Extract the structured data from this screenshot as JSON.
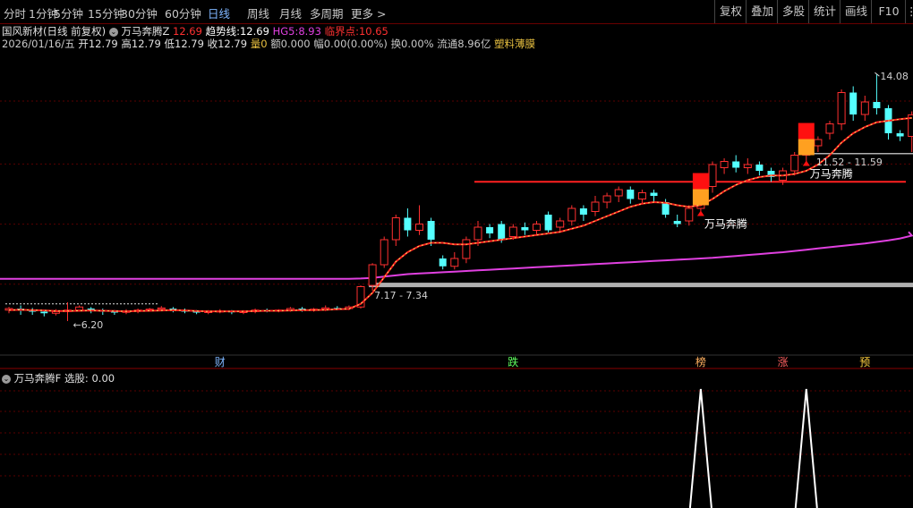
{
  "toolbar": {
    "periods": [
      {
        "label": "分时",
        "active": false
      },
      {
        "label": "1分钟",
        "active": false
      },
      {
        "label": "5分钟",
        "active": false
      },
      {
        "label": "15分钟",
        "active": false
      },
      {
        "label": "30分钟",
        "active": false
      },
      {
        "label": "60分钟",
        "active": false
      },
      {
        "label": "日线",
        "active": true
      },
      {
        "label": "周线",
        "active": false
      },
      {
        "label": "月线",
        "active": false
      },
      {
        "label": "多周期",
        "active": false
      },
      {
        "label": "更多 >",
        "active": false
      }
    ],
    "right_buttons": [
      "复权",
      "叠加",
      "多股",
      "统计",
      "画线",
      "F10"
    ],
    "right_icon": "grid-icon"
  },
  "stock": {
    "title": "国风新材(日线 前复权)",
    "indicator_name": "万马奔腾Z",
    "indicator_value": "12.69",
    "trend_label": "趋势线:",
    "trend_value": "12.69",
    "hg5_label": "HG5:",
    "hg5_value": "8.93",
    "critical_label": "临界点:",
    "critical_value": "10.65"
  },
  "quote": {
    "date": "2026/01/16/五",
    "open": "开12.79",
    "high": "高12.79",
    "low": "低12.79",
    "close": "收12.79",
    "volume": "量0",
    "amount": "额0.000",
    "change": "幅0.00(0.00%)",
    "turnover": "换0.00%",
    "float": "流通8.96亿",
    "sector": "塑料薄膜"
  },
  "annotations": {
    "high_marker": "14.08",
    "low_marker": "6.20",
    "range_low": "7.17 - 7.34",
    "range_high": "11.52 - 11.59",
    "signal_1": "万马奔腾",
    "signal_2": "万马奔腾"
  },
  "event_markers": [
    "财",
    "跌",
    "榜",
    "涨",
    "预"
  ],
  "sub_indicator": {
    "name": "万马奔腾F",
    "label": "选股: 0.00"
  },
  "colors": {
    "up": "#ff3030",
    "down": "#54ffff",
    "trend": "#ff2020",
    "hg5": "#e040e0",
    "critical": "#ff2020",
    "support": "#b0b0b0",
    "signal_red": "#ff1010",
    "signal_orange": "#ffa020",
    "gold": "#e8c040"
  },
  "chart_data": {
    "type": "candlestick",
    "ylim": [
      5.4,
      14.6
    ],
    "candles": [
      [
        6.55,
        6.6,
        6.5,
        6.65,
        6.45
      ],
      [
        6.6,
        6.55,
        6.45,
        6.7,
        6.4
      ],
      [
        6.55,
        6.5,
        6.45,
        6.62,
        6.4
      ],
      [
        6.5,
        6.45,
        6.4,
        6.55,
        6.35
      ],
      [
        6.45,
        6.5,
        6.42,
        6.58,
        6.38
      ],
      [
        6.5,
        6.55,
        6.45,
        6.8,
        6.2
      ],
      [
        6.55,
        6.65,
        6.55,
        6.7,
        6.5
      ],
      [
        6.6,
        6.55,
        6.5,
        6.65,
        6.45
      ],
      [
        6.55,
        6.5,
        6.45,
        6.6,
        6.4
      ],
      [
        6.5,
        6.48,
        6.45,
        6.55,
        6.4
      ],
      [
        6.48,
        6.52,
        6.45,
        6.58,
        6.42
      ],
      [
        6.52,
        6.55,
        6.48,
        6.6,
        6.45
      ],
      [
        6.55,
        6.58,
        6.52,
        6.62,
        6.5
      ],
      [
        6.58,
        6.62,
        6.55,
        6.68,
        6.52
      ],
      [
        6.6,
        6.55,
        6.52,
        6.65,
        6.48
      ],
      [
        6.55,
        6.5,
        6.48,
        6.6,
        6.45
      ],
      [
        6.5,
        6.48,
        6.45,
        6.55,
        6.42
      ],
      [
        6.48,
        6.5,
        6.45,
        6.55,
        6.42
      ],
      [
        6.5,
        6.52,
        6.48,
        6.58,
        6.45
      ],
      [
        6.52,
        6.48,
        6.45,
        6.55,
        6.42
      ],
      [
        6.48,
        6.5,
        6.45,
        6.55,
        6.42
      ],
      [
        6.5,
        6.55,
        6.48,
        6.6,
        6.45
      ],
      [
        6.55,
        6.52,
        6.5,
        6.6,
        6.48
      ],
      [
        6.52,
        6.55,
        6.5,
        6.58,
        6.48
      ],
      [
        6.55,
        6.6,
        6.52,
        6.65,
        6.5
      ],
      [
        6.6,
        6.55,
        6.52,
        6.65,
        6.5
      ],
      [
        6.55,
        6.58,
        6.52,
        6.62,
        6.5
      ],
      [
        6.58,
        6.62,
        6.55,
        6.7,
        6.52
      ],
      [
        6.62,
        6.6,
        6.58,
        6.68,
        6.55
      ],
      [
        6.6,
        6.65,
        6.58,
        6.7,
        6.55
      ],
      [
        6.65,
        7.3,
        6.62,
        7.34,
        6.6
      ],
      [
        7.34,
        8.0,
        7.3,
        8.05,
        7.17
      ],
      [
        8.0,
        8.8,
        7.95,
        8.9,
        7.9
      ],
      [
        8.8,
        9.5,
        8.7,
        9.6,
        8.6
      ],
      [
        9.5,
        9.1,
        9.0,
        9.8,
        8.9
      ],
      [
        9.1,
        9.3,
        9.0,
        9.9,
        8.95
      ],
      [
        9.4,
        8.8,
        8.7,
        9.5,
        8.6
      ],
      [
        8.2,
        7.95,
        7.9,
        8.3,
        7.85
      ],
      [
        7.95,
        8.2,
        7.9,
        8.4,
        7.85
      ],
      [
        8.2,
        8.8,
        8.1,
        8.9,
        8.05
      ],
      [
        8.8,
        9.2,
        8.7,
        9.4,
        8.6
      ],
      [
        9.2,
        9.0,
        8.9,
        9.3,
        8.85
      ],
      [
        9.3,
        8.8,
        8.75,
        9.4,
        8.7
      ],
      [
        8.9,
        9.2,
        8.85,
        9.3,
        8.8
      ],
      [
        9.2,
        9.1,
        9.0,
        9.35,
        8.95
      ],
      [
        9.1,
        9.3,
        9.0,
        9.4,
        8.95
      ],
      [
        9.6,
        9.1,
        9.05,
        9.7,
        9.0
      ],
      [
        9.2,
        9.4,
        9.1,
        9.5,
        9.05
      ],
      [
        9.4,
        9.8,
        9.3,
        9.9,
        9.25
      ],
      [
        9.8,
        9.6,
        9.5,
        9.9,
        9.4
      ],
      [
        9.7,
        10.0,
        9.6,
        10.2,
        9.55
      ],
      [
        10.0,
        10.2,
        9.9,
        10.3,
        9.8
      ],
      [
        10.2,
        10.4,
        10.1,
        10.5,
        10.0
      ],
      [
        10.4,
        10.1,
        10.0,
        10.5,
        9.95
      ],
      [
        10.1,
        10.3,
        10.0,
        10.4,
        9.95
      ],
      [
        10.3,
        10.2,
        10.1,
        10.4,
        10.0
      ],
      [
        10.0,
        9.6,
        9.55,
        10.1,
        9.5
      ],
      [
        9.4,
        9.3,
        9.25,
        9.6,
        9.2
      ],
      [
        9.4,
        9.8,
        9.3,
        9.9,
        9.25
      ],
      [
        9.8,
        10.2,
        9.7,
        10.3,
        9.65
      ],
      [
        10.5,
        11.2,
        10.4,
        11.3,
        10.3
      ],
      [
        11.1,
        11.3,
        11.0,
        11.4,
        10.9
      ],
      [
        11.3,
        11.1,
        11.0,
        11.5,
        10.95
      ],
      [
        11.1,
        11.2,
        11.0,
        11.4,
        10.9
      ],
      [
        11.2,
        11.0,
        10.9,
        11.3,
        10.85
      ],
      [
        11.0,
        10.8,
        10.7,
        11.1,
        10.65
      ],
      [
        10.7,
        11.0,
        10.6,
        11.1,
        10.55
      ],
      [
        11.0,
        11.5,
        10.9,
        11.6,
        10.85
      ],
      [
        11.5,
        11.8,
        11.4,
        11.9,
        11.3
      ],
      [
        11.8,
        12.0,
        11.7,
        12.1,
        11.6
      ],
      [
        12.2,
        12.5,
        12.1,
        12.6,
        12.0
      ],
      [
        12.5,
        13.5,
        12.4,
        13.6,
        12.3
      ],
      [
        13.5,
        12.8,
        12.7,
        13.7,
        12.6
      ],
      [
        12.8,
        13.2,
        12.7,
        13.4,
        12.6
      ],
      [
        13.2,
        13.0,
        12.9,
        14.08,
        12.8
      ],
      [
        13.0,
        12.2,
        12.1,
        13.1,
        12.0
      ],
      [
        12.2,
        12.1,
        12.0,
        12.3,
        11.95
      ],
      [
        12.1,
        12.79,
        12.0,
        12.9,
        11.6
      ]
    ],
    "trend_line": [
      6.55,
      6.56,
      6.55,
      6.54,
      6.52,
      6.52,
      6.53,
      6.54,
      6.53,
      6.52,
      6.51,
      6.52,
      6.53,
      6.54,
      6.55,
      6.54,
      6.52,
      6.51,
      6.51,
      6.51,
      6.51,
      6.52,
      6.53,
      6.53,
      6.54,
      6.55,
      6.55,
      6.56,
      6.58,
      6.59,
      6.75,
      7.1,
      7.6,
      8.1,
      8.4,
      8.6,
      8.7,
      8.7,
      8.65,
      8.65,
      8.7,
      8.75,
      8.8,
      8.85,
      8.9,
      8.95,
      9.0,
      9.05,
      9.15,
      9.25,
      9.4,
      9.55,
      9.7,
      9.85,
      9.95,
      10.0,
      9.98,
      9.9,
      9.85,
      9.9,
      10.1,
      10.35,
      10.55,
      10.7,
      10.8,
      10.85,
      10.85,
      10.9,
      11.0,
      11.2,
      11.5,
      11.9,
      12.2,
      12.4,
      12.55,
      12.6,
      12.65,
      12.69
    ],
    "hg5_line": [
      7.55,
      7.55,
      7.55,
      7.55,
      7.55,
      7.55,
      7.55,
      7.55,
      7.55,
      7.55,
      7.55,
      7.55,
      7.55,
      7.55,
      7.55,
      7.55,
      7.55,
      7.55,
      7.55,
      7.55,
      7.55,
      7.55,
      7.55,
      7.55,
      7.55,
      7.55,
      7.55,
      7.55,
      7.55,
      7.55,
      7.56,
      7.58,
      7.62,
      7.66,
      7.7,
      7.72,
      7.74,
      7.76,
      7.78,
      7.8,
      7.82,
      7.84,
      7.86,
      7.88,
      7.9,
      7.92,
      7.94,
      7.96,
      7.98,
      8.0,
      8.02,
      8.04,
      8.06,
      8.08,
      8.1,
      8.12,
      8.14,
      8.16,
      8.18,
      8.2,
      8.22,
      8.25,
      8.28,
      8.31,
      8.34,
      8.37,
      8.4,
      8.44,
      8.48,
      8.52,
      8.56,
      8.6,
      8.64,
      8.68,
      8.73,
      8.78,
      8.84,
      8.93
    ],
    "critical_level": 10.65,
    "range_low_level": 7.34,
    "range_high_level": 11.55,
    "signals": [
      59,
      68
    ],
    "sub_peaks": [
      59,
      68
    ],
    "events": [
      {
        "label": "财",
        "index": 18,
        "color": "#7fb6ff"
      },
      {
        "label": "跌",
        "index": 43,
        "color": "#60ff60"
      },
      {
        "label": "榜",
        "index": 59,
        "color": "#ffb060"
      },
      {
        "label": "涨",
        "index": 66,
        "color": "#ff6060"
      },
      {
        "label": "预",
        "index": 73,
        "color": "#ffd040"
      }
    ]
  }
}
